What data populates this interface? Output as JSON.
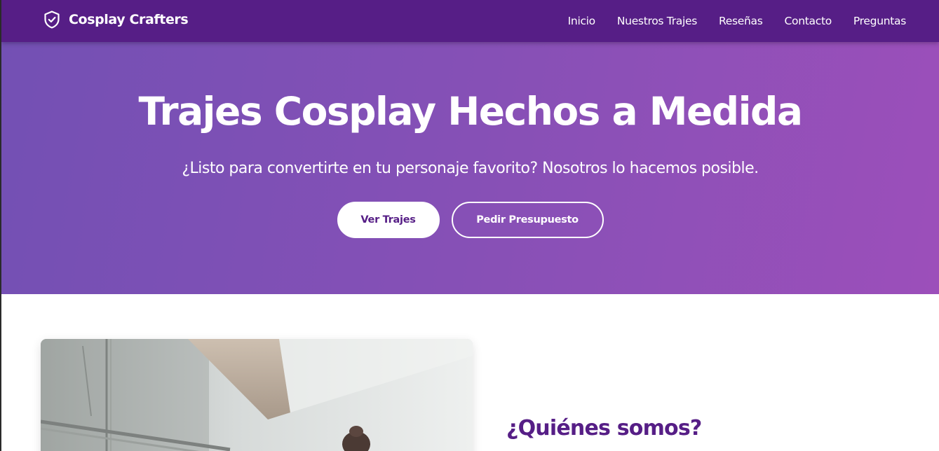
{
  "brand": {
    "name": "Cosplay Crafters",
    "icon": "shield-check-icon"
  },
  "nav": {
    "items": [
      {
        "label": "Inicio"
      },
      {
        "label": "Nuestros Trajes"
      },
      {
        "label": "Reseñas"
      },
      {
        "label": "Contacto"
      },
      {
        "label": "Preguntas"
      }
    ]
  },
  "hero": {
    "title": "Trajes Cosplay Hechos a Medida",
    "subtitle": "¿Listo para convertirte en tu personaje favorito? Nosotros lo hacemos posible.",
    "primary_button": "Ver Trajes",
    "secondary_button": "Pedir Presupuesto"
  },
  "about": {
    "title": "¿Quiénes somos?"
  },
  "colors": {
    "navbar": "#561e86",
    "hero_start": "#7350b4",
    "hero_end": "#9c4fba",
    "accent_text": "#561e86",
    "button_text_light": "#ffffff"
  }
}
